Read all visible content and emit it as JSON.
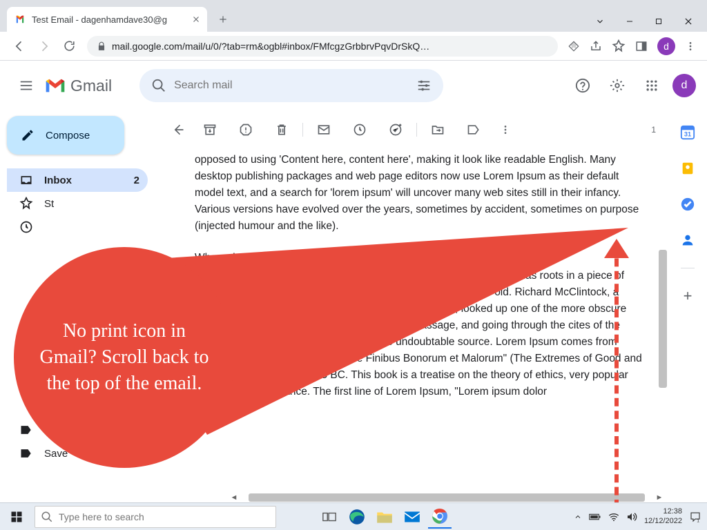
{
  "browser": {
    "tab_title": "Test Email - dagenhamdave30@g",
    "url": "mail.google.com/mail/u/0/?tab=rm&ogbl#inbox/FMfcgzGrbbrvPqvDrSkQ…"
  },
  "gmail": {
    "brand": "Gmail",
    "search_placeholder": "Search mail",
    "compose": "Compose",
    "avatar_letter": "d",
    "counter": "1",
    "nav": {
      "inbox": "Inbox",
      "inbox_count": "2",
      "starred": "Starred",
      "snoozed": "Snoozed",
      "saved_bottom": "Save"
    },
    "body_p1": "opposed to using 'Content here, content here', making it look like readable English. Many desktop publishing packages and web page editors now use Lorem Ipsum as their default model text, and a search for 'lorem ipsum' will uncover many web sites still in their infancy. Various versions have evolved over the years, sometimes by accident, sometimes on purpose (injected humour and the like).",
    "body_h": "Where does it come from?",
    "body_p2": "Contrary to popular belief, Lorem Ipsum is not simply random text. It has roots in a piece of classical Latin literature from 45 BC, making it over 2000 years old. Richard McClintock, a Latin professor at Hampden-Sydney College in Virginia, looked up one of the more obscure Latin words, consectetur, from a Lorem Ipsum passage, and going through the cites of the word in classical literature, discovered the undoubtable source. Lorem Ipsum comes from sections 1.10.32 and 1.10.33 of \"de Finibus Bonorum et Malorum\" (The Extremes of Good and Evil) by Cicero, written in 45 BC. This book is a treatise on the theory of ethics, very popular during the Renaissance. The first line of Lorem Ipsum, \"Lorem ipsum dolor"
  },
  "annotation": {
    "text": "No print icon in Gmail? Scroll back to the top of the email."
  },
  "taskbar": {
    "search_placeholder": "Type here to search",
    "time": "12:38",
    "date": "12/12/2022"
  }
}
